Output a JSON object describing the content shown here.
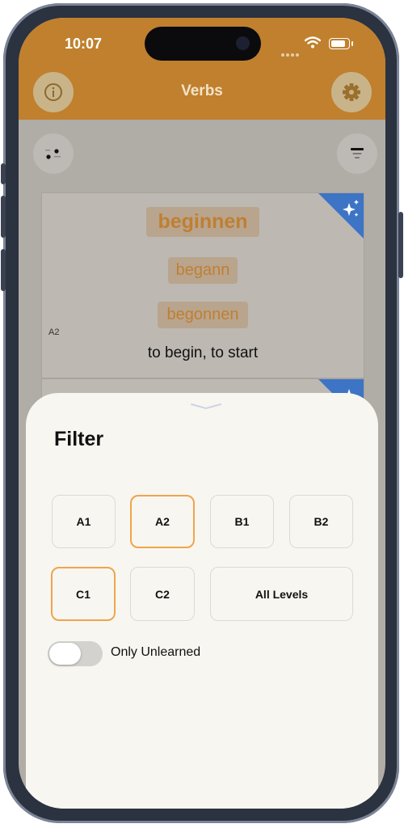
{
  "status_bar": {
    "time": "10:07"
  },
  "nav": {
    "title": "Verbs",
    "info_icon": "info-icon",
    "settings_icon": "gear-icon"
  },
  "toolbar": {
    "left_icon": "dice-icon",
    "right_icon": "sort-icon"
  },
  "cards": [
    {
      "infinitive": "beginnen",
      "preterite": "begann",
      "participle": "begonnen",
      "meaning": "to begin, to start",
      "level": "A2",
      "badge_icon": "sparkles-icon"
    }
  ],
  "filter_sheet": {
    "title": "Filter",
    "levels": [
      {
        "label": "A1",
        "selected": false
      },
      {
        "label": "A2",
        "selected": true
      },
      {
        "label": "B1",
        "selected": false
      },
      {
        "label": "B2",
        "selected": false
      },
      {
        "label": "C1",
        "selected": true
      },
      {
        "label": "C2",
        "selected": false
      },
      {
        "label": "All Levels",
        "selected": false
      }
    ],
    "toggle": {
      "label": "Only Unlearned",
      "on": false
    }
  },
  "colors": {
    "accent": "#c0802e",
    "selected_border": "#f0a44b",
    "sheet_background": "#f8f6f1",
    "badge": "#3d74c5"
  }
}
